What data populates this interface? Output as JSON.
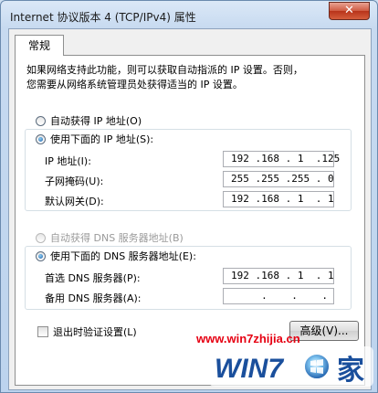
{
  "window": {
    "title": "Internet 协议版本 4 (TCP/IPv4) 属性",
    "close_symbol": "✕"
  },
  "tabs": [
    {
      "label": "常规",
      "active": true
    }
  ],
  "description": [
    "如果网络支持此功能，则可以获取自动指派的 IP 设置。否则，",
    "您需要从网络系统管理员处获得适当的 IP 设置。"
  ],
  "ip_section": {
    "auto_label": "自动获得 IP 地址(O)",
    "manual_label": "使用下面的 IP 地址(S):",
    "selected": "manual",
    "fields": [
      {
        "label": "IP 地址(I):",
        "value": "192 .168 . 1  .125"
      },
      {
        "label": "子网掩码(U):",
        "value": "255 .255 .255 . 0"
      },
      {
        "label": "默认网关(D):",
        "value": "192 .168 . 1  . 1"
      }
    ]
  },
  "dns_section": {
    "auto_label": "自动获得 DNS 服务器地址(B)",
    "manual_label": "使用下面的 DNS 服务器地址(E):",
    "selected": "manual",
    "fields": [
      {
        "label": "首选 DNS 服务器(P):",
        "value": "192 .168 . 1  . 1"
      },
      {
        "label": "备用 DNS 服务器(A):",
        "value": "     .    .    ."
      }
    ]
  },
  "validate_on_exit_label": "退出时验证设置(L)",
  "advanced_button_label": "高级(V)...",
  "watermark": {
    "url": "www.win7zhijia.cn",
    "logo_text": "WIN7",
    "logo_suffix": "家",
    "accent": "#e60012",
    "logo_color": "#1a4f9c"
  }
}
